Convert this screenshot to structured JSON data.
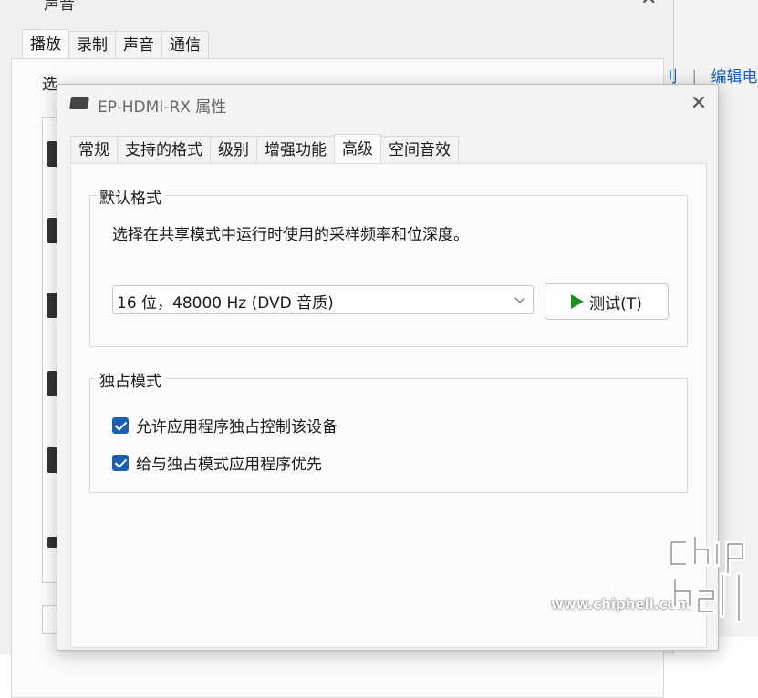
{
  "back_window": {
    "title": "声音",
    "tabs": [
      {
        "label": "播放",
        "active": true
      },
      {
        "label": "录制",
        "active": false
      },
      {
        "label": "声音",
        "active": false
      },
      {
        "label": "通信",
        "active": false
      }
    ],
    "select_label": "选",
    "link_partial": "刂",
    "link_separator": "|",
    "edit_link": "编辑电"
  },
  "dialog": {
    "title": "EP-HDMI-RX 属性",
    "close_glyph": "✕",
    "tabs": [
      {
        "label": "常规",
        "active": false
      },
      {
        "label": "支持的格式",
        "active": false
      },
      {
        "label": "级别",
        "active": false
      },
      {
        "label": "增强功能",
        "active": false
      },
      {
        "label": "高级",
        "active": true
      },
      {
        "label": "空间音效",
        "active": false
      }
    ],
    "default_format": {
      "group_title": "默认格式",
      "description": "选择在共享模式中运行时使用的采样频率和位深度。",
      "selected_format": "16 位，48000 Hz (DVD 音质)",
      "test_button": "测试(T)"
    },
    "exclusive_mode": {
      "group_title": "独占模式",
      "options": [
        {
          "label": "允许应用程序独占控制该设备",
          "checked": true
        },
        {
          "label": "给与独占模式应用程序优先",
          "checked": true
        }
      ]
    }
  },
  "watermark": {
    "site": "www.chiphell.com",
    "logo_text": "chiphell"
  },
  "colors": {
    "accent": "#1a5fb4",
    "play_green": "#1f8f1f"
  }
}
